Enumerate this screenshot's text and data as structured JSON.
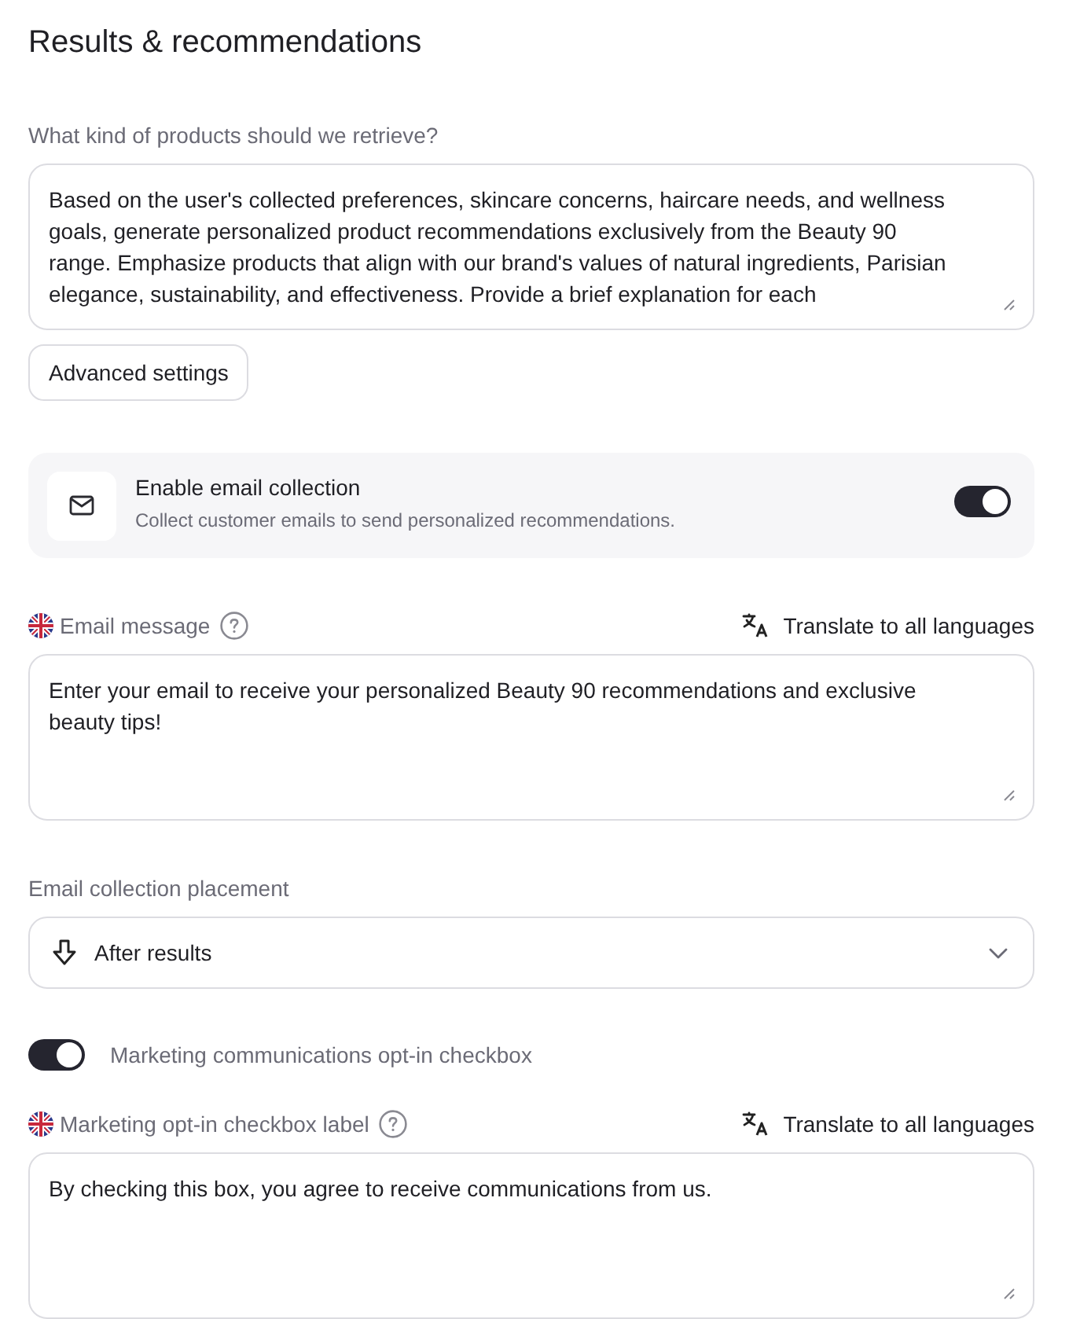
{
  "title": "Results & recommendations",
  "products": {
    "label": "What kind of products should we retrieve?",
    "value": "Based on the user's collected preferences, skincare concerns, haircare needs, and wellness goals, generate personalized product recommendations exclusively from the Beauty 90 range. Emphasize products that align with our brand's values of natural ingredients, Parisian elegance, sustainability, and effectiveness. Provide a brief explanation for each"
  },
  "advanced_button": "Advanced settings",
  "email_collection": {
    "title": "Enable email collection",
    "description": "Collect customer emails to send personalized recommendations.",
    "on": true
  },
  "email_message": {
    "label": "Email message",
    "translate": "Translate to all languages",
    "value": "Enter your email to receive your personalized Beauty 90 recommendations and exclusive beauty tips!"
  },
  "placement": {
    "label": "Email collection placement",
    "value": "After results"
  },
  "marketing_opt_in": {
    "label": "Marketing communications opt-in checkbox",
    "on": true
  },
  "opt_in_label": {
    "label": "Marketing opt-in checkbox label",
    "translate": "Translate to all languages",
    "value": "By checking this box, you agree to receive communications from us."
  }
}
